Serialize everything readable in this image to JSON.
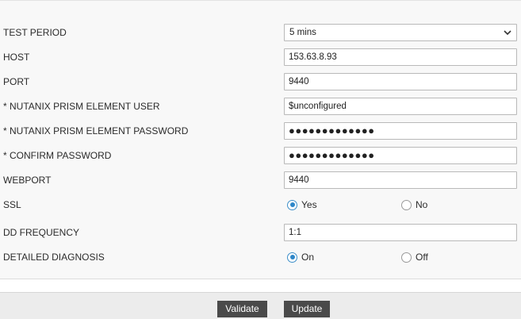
{
  "form": {
    "test_period": {
      "label": "TEST PERIOD",
      "value": "5 mins"
    },
    "host": {
      "label": "HOST",
      "value": "153.63.8.93"
    },
    "port": {
      "label": "PORT",
      "value": "9440"
    },
    "user": {
      "label": "* NUTANIX PRISM ELEMENT USER",
      "value": "$unconfigured"
    },
    "password": {
      "label": "* NUTANIX PRISM ELEMENT PASSWORD",
      "value": "●●●●●●●●●●●●●"
    },
    "confirm_password": {
      "label": "* CONFIRM PASSWORD",
      "value": "●●●●●●●●●●●●●"
    },
    "webport": {
      "label": "WEBPORT",
      "value": "9440"
    },
    "ssl": {
      "label": "SSL",
      "options": [
        "Yes",
        "No"
      ],
      "selected": "Yes"
    },
    "dd_frequency": {
      "label": "DD FREQUENCY",
      "value": "1:1"
    },
    "detailed_diagnosis": {
      "label": "DETAILED DIAGNOSIS",
      "options": [
        "On",
        "Off"
      ],
      "selected": "On"
    }
  },
  "buttons": {
    "validate": "Validate",
    "update": "Update"
  },
  "colors": {
    "button_bg": "#4a4a4a",
    "radio_accent": "#2d86c8",
    "form_bg": "#f8f8f8"
  }
}
